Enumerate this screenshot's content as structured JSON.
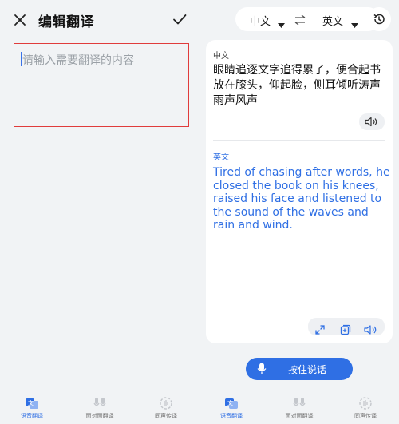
{
  "editor": {
    "title": "编辑翻译",
    "input_placeholder": "请输入需要翻译的内容"
  },
  "language_bar": {
    "source": "中文",
    "target": "英文"
  },
  "result": {
    "source_lang": "中文",
    "source_text": "眼睛追逐文字追得累了，便合起书放在膝头，仰起脸，侧耳倾听涛声雨声风声",
    "target_lang": "英文",
    "target_text": "Tired of chasing after words, he closed the book on his knees, raised his face and listened to the sound of the waves and rain and wind."
  },
  "hold_to_speak": "按住说话",
  "tabs": [
    {
      "label": "语音翻译"
    },
    {
      "label": "面对面翻译"
    },
    {
      "label": "同声传译"
    }
  ],
  "colors": {
    "accent": "#2f6fe4",
    "highlight_border": "#e03b3b",
    "background": "#f1f3f5"
  },
  "icons": [
    "close-icon",
    "check-icon",
    "swap-icon",
    "history-icon",
    "speaker-icon",
    "fullscreen-icon",
    "copy-icon",
    "microphone-icon",
    "voice-translate-icon",
    "face-to-face-icon",
    "simultaneous-icon"
  ]
}
